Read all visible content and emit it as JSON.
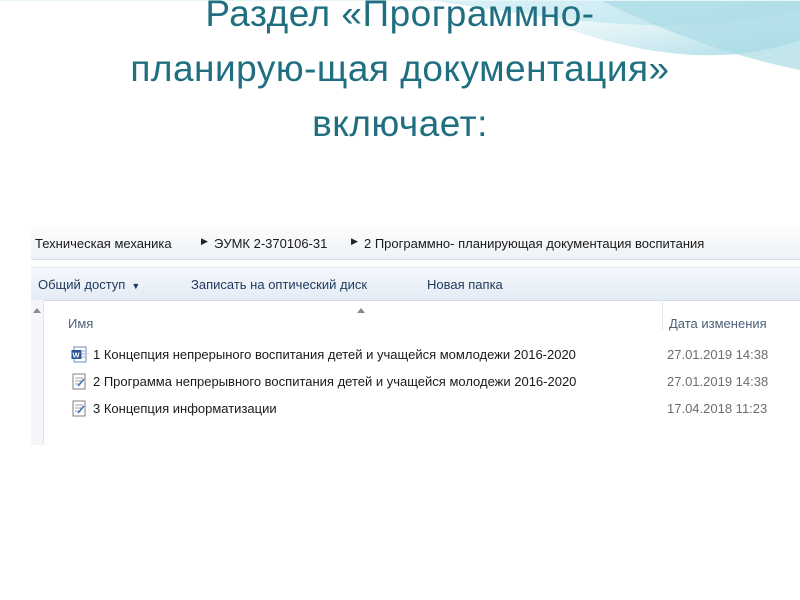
{
  "slide": {
    "title_lines": [
      "Раздел «Программно-",
      "планирую-щая документация»",
      "включает:"
    ]
  },
  "explorer": {
    "breadcrumbs": [
      "Техническая механика",
      "ЭУМК 2-370106-31",
      "2 Программно- планирующая документация воспитания"
    ],
    "toolbar": {
      "share": "Общий доступ",
      "burn": "Записать на оптический диск",
      "new_folder": "Новая папка"
    },
    "columns": {
      "name": "Имя",
      "date": "Дата изменения"
    },
    "files": [
      {
        "name": "1 Концепция непрерыного воспитания детей и учащейся момлодежи 2016-2020",
        "date": "27.01.2019 14:38",
        "icon": "word-document-icon"
      },
      {
        "name": "2 Программа непрерывного воспитания детей и учащейся молодежи 2016-2020",
        "date": "27.01.2019 14:38",
        "icon": "text-document-icon"
      },
      {
        "name": "3 Концепция информатизации",
        "date": "17.04.2018 11:23",
        "icon": "text-document-icon"
      }
    ]
  },
  "colors": {
    "title": "#1f6f80",
    "toolbar_text": "#1e395b",
    "header_text": "#4c607a",
    "date_text": "#6d6d6d"
  }
}
